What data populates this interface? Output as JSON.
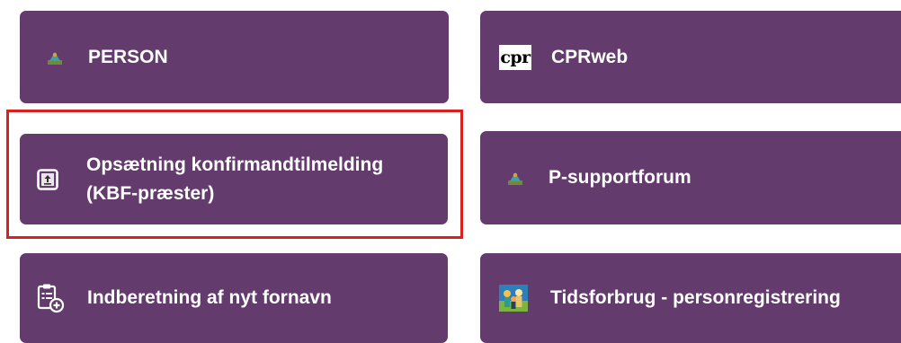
{
  "tiles": {
    "person": {
      "label": "PERSON",
      "icon": "person-app-icon"
    },
    "cprweb": {
      "label": "CPRweb",
      "icon": "cpr-logo-icon",
      "logo_text": "cpr"
    },
    "opsaetning": {
      "label_line1": "Opsætning konfirmandtilmelding",
      "label_line2": "(KBF-præster)",
      "icon": "upload-form-icon",
      "highlighted": true
    },
    "psupportforum": {
      "label": "P-supportforum",
      "icon": "person-app-icon"
    },
    "indberetning": {
      "label": "Indberetning af nyt fornavn",
      "icon": "add-form-icon"
    },
    "tidsforbrug": {
      "label": "Tidsforbrug - personregistrering",
      "icon": "people-picture-icon"
    }
  },
  "colors": {
    "tile_background": "#633b6c",
    "tile_text": "#ffffff",
    "highlight_border": "#d9211f",
    "page_background": "#ffffff"
  }
}
